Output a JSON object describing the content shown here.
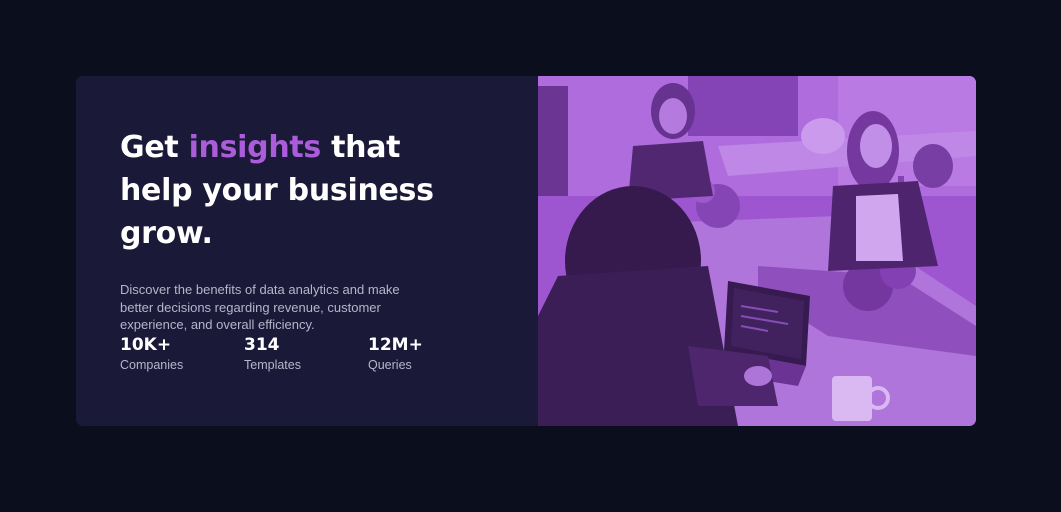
{
  "hero": {
    "headline_before": "Get ",
    "headline_accent": "insights",
    "headline_after": " that help your business grow.",
    "description": "Discover the benefits of data analytics and make better decisions regarding revenue, customer experience, and overall efficiency."
  },
  "stats": [
    {
      "value": "10K+",
      "label": "Companies"
    },
    {
      "value": "314",
      "label": "Templates"
    },
    {
      "value": "12M+",
      "label": "Queries"
    }
  ],
  "colors": {
    "page_background": "#0b0e1d",
    "card_background": "#1b1938",
    "accent": "#ab5cdb",
    "image_overlay": "#a45fd6",
    "body_text": "#b7b5c9"
  },
  "image": {
    "subject": "people-working-in-office"
  }
}
